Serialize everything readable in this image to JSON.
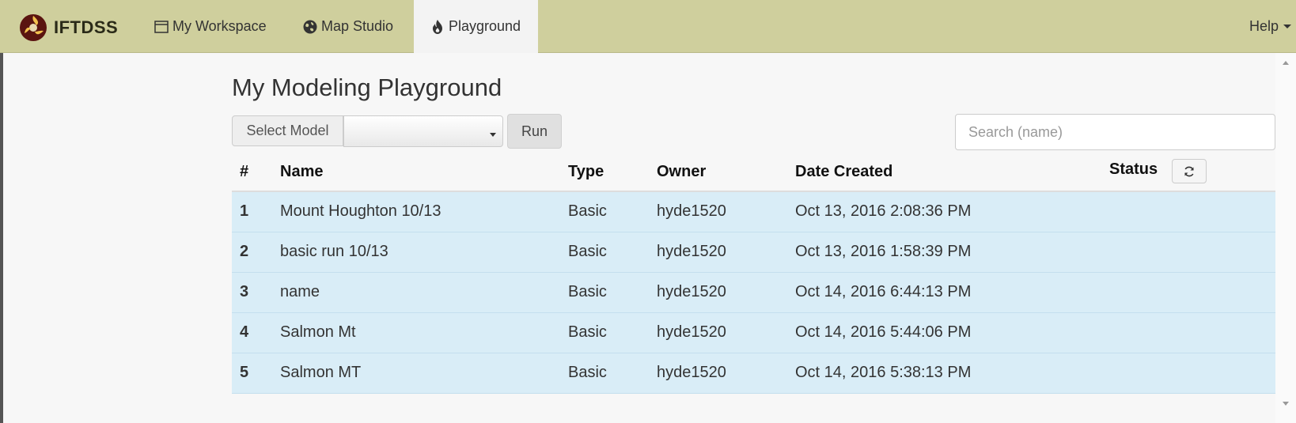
{
  "nav": {
    "brand": "IFTDSS",
    "items": [
      {
        "label": "My Workspace",
        "icon": "window-icon"
      },
      {
        "label": "Map Studio",
        "icon": "globe-icon"
      },
      {
        "label": "Playground",
        "icon": "fire-icon",
        "active": true
      }
    ],
    "help": "Help"
  },
  "page": {
    "title": "My Modeling Playground"
  },
  "toolbar": {
    "select_model_label": "Select Model",
    "model_value": "",
    "run_label": "Run",
    "search_placeholder": "Search (name)"
  },
  "table": {
    "columns": [
      "#",
      "Name",
      "Type",
      "Owner",
      "Date Created",
      "Status"
    ],
    "rows": [
      {
        "num": "1",
        "name": "Mount Houghton 10/13",
        "type": "Basic",
        "owner": "hyde1520",
        "date": "Oct 13, 2016 2:08:36 PM",
        "status": ""
      },
      {
        "num": "2",
        "name": "basic run 10/13",
        "type": "Basic",
        "owner": "hyde1520",
        "date": "Oct 13, 2016 1:58:39 PM",
        "status": ""
      },
      {
        "num": "3",
        "name": "name",
        "type": "Basic",
        "owner": "hyde1520",
        "date": "Oct 14, 2016 6:44:13 PM",
        "status": ""
      },
      {
        "num": "4",
        "name": "Salmon Mt",
        "type": "Basic",
        "owner": "hyde1520",
        "date": "Oct 14, 2016 5:44:06 PM",
        "status": ""
      },
      {
        "num": "5",
        "name": "Salmon MT",
        "type": "Basic",
        "owner": "hyde1520",
        "date": "Oct 14, 2016 5:38:13 PM",
        "status": ""
      }
    ]
  },
  "colors": {
    "navbar": "#cfcf9d",
    "row_highlight": "#d9edf7",
    "active_tab": "#f3f3f3"
  }
}
